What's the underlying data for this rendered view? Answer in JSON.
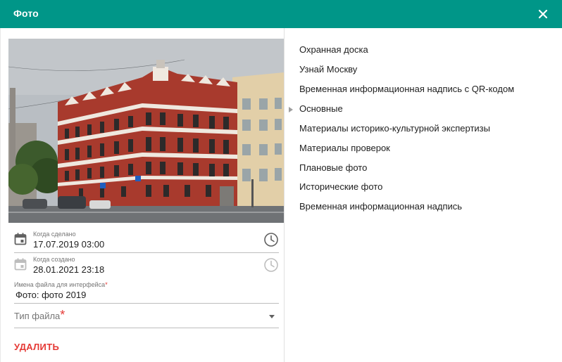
{
  "dialog": {
    "title": "Фото"
  },
  "fields": {
    "taken": {
      "label": "Когда сделано",
      "value": "17.07.2019 03:00"
    },
    "created": {
      "label": "Когда создано",
      "value": "28.01.2021 23:18"
    },
    "filename": {
      "label": "Имена файла для интерфейса",
      "required_mark": "*",
      "value": "Фото: фото 2019"
    },
    "filetype": {
      "label": "Тип файла",
      "required_mark": "*",
      "value": ""
    }
  },
  "actions": {
    "delete_label": "УДАЛИТЬ"
  },
  "tree": {
    "items": [
      {
        "label": "Охранная доска",
        "expandable": false
      },
      {
        "label": "Узнай Москву",
        "expandable": false
      },
      {
        "label": "Временная информационная надпись с QR-кодом",
        "expandable": false
      },
      {
        "label": "Основные",
        "expandable": true
      },
      {
        "label": "Материалы историко-культурной экспертизы",
        "expandable": false
      },
      {
        "label": "Материалы проверок",
        "expandable": false
      },
      {
        "label": "Плановые фото",
        "expandable": false
      },
      {
        "label": "Исторические фото",
        "expandable": false
      },
      {
        "label": "Временная информационная надпись",
        "expandable": false
      }
    ]
  },
  "colors": {
    "header": "#009688",
    "danger": "#e53935"
  },
  "icons": {
    "close": "close-icon",
    "calendar": "calendar-icon",
    "clock": "clock-icon",
    "dropdown": "chevron-down-icon",
    "expand": "triangle-right-icon"
  }
}
